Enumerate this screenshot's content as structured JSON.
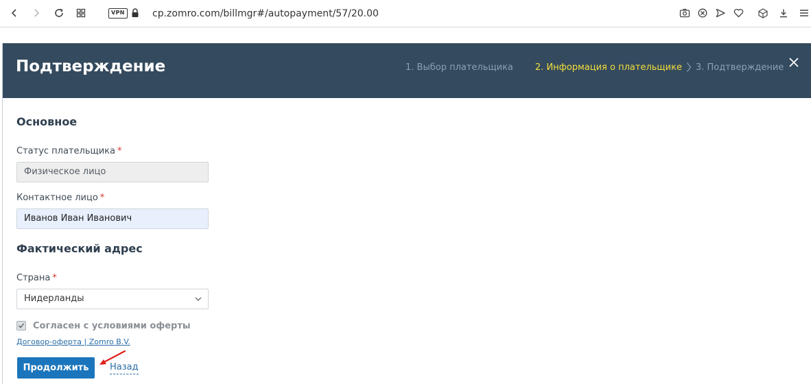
{
  "browser": {
    "url": "cp.zomro.com/billmgr#/autopayment/57/20.00",
    "vpn_label": "VPN"
  },
  "dialog": {
    "title": "Подтверждение",
    "steps": [
      {
        "label": "1. Выбор плательщика",
        "state": "done"
      },
      {
        "label": "2. Информация о плательщике",
        "state": "active"
      },
      {
        "label": "3. Подтверждение",
        "state": "pending"
      }
    ],
    "colors": {
      "header_bg": "#344a5e",
      "active_step": "#f4df3a",
      "button_bg": "#1b75bc"
    }
  },
  "form": {
    "section_main": "Основное",
    "payer_status": {
      "label": "Статус плательщика",
      "value": "Физическое лицо",
      "required": "*"
    },
    "contact_person": {
      "label": "Контактное лицо",
      "value": "Иванов Иван Иванович",
      "required": "*"
    },
    "section_address": "Фактический адрес",
    "country": {
      "label": "Страна",
      "value": "Нидерланды",
      "required": "*"
    },
    "agree": {
      "label": "Согласен с условиями оферты",
      "checked": true
    },
    "offer_link": "Договор-оферта | Zomro B.V.",
    "continue_label": "Продолжить",
    "back_label": "Назад"
  }
}
